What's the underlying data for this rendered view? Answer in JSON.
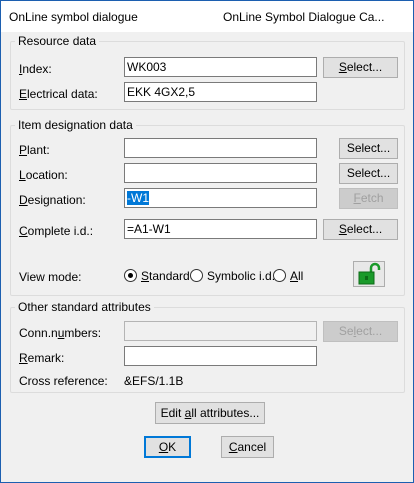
{
  "window": {
    "title": "OnLine symbol dialogue",
    "subtitle": "OnLine Symbol Dialogue Ca..."
  },
  "resource": {
    "legend": "Resource data",
    "index_label": "Index:",
    "index_value": "WK003",
    "index_select": "Select...",
    "electrical_label": "Electrical data:",
    "electrical_value": "EKK 4GX2,5"
  },
  "item": {
    "legend": "Item designation data",
    "plant_label": "Plant:",
    "plant_value": "",
    "plant_select": "Select...",
    "location_label": "Location:",
    "location_value": "",
    "location_select": "Select...",
    "designation_label": "Designation:",
    "designation_value": "-W1",
    "fetch_label": "Fetch",
    "complete_label": "Complete i.d.:",
    "complete_value": "=A1-W1",
    "complete_select": "Select...",
    "view_mode_label": "View mode:",
    "view_modes": [
      "Standard",
      "Symbolic i.d.",
      "All"
    ],
    "view_mode_selected": "Standard",
    "lock_icon": "unlocked-padlock-icon"
  },
  "other": {
    "legend": "Other standard attributes",
    "conn_label": "Conn.numbers:",
    "conn_value": "",
    "conn_select": "Select...",
    "remark_label": "Remark:",
    "remark_value": "",
    "xref_label": "Cross reference:",
    "xref_value": "&EFS/1.1B"
  },
  "footer": {
    "edit_all": "Edit all attributes...",
    "ok": "OK",
    "cancel": "Cancel"
  },
  "colors": {
    "border_accent": "#1c5fb0",
    "selection": "#0078d7",
    "lock_green": "#1a9a2a"
  }
}
